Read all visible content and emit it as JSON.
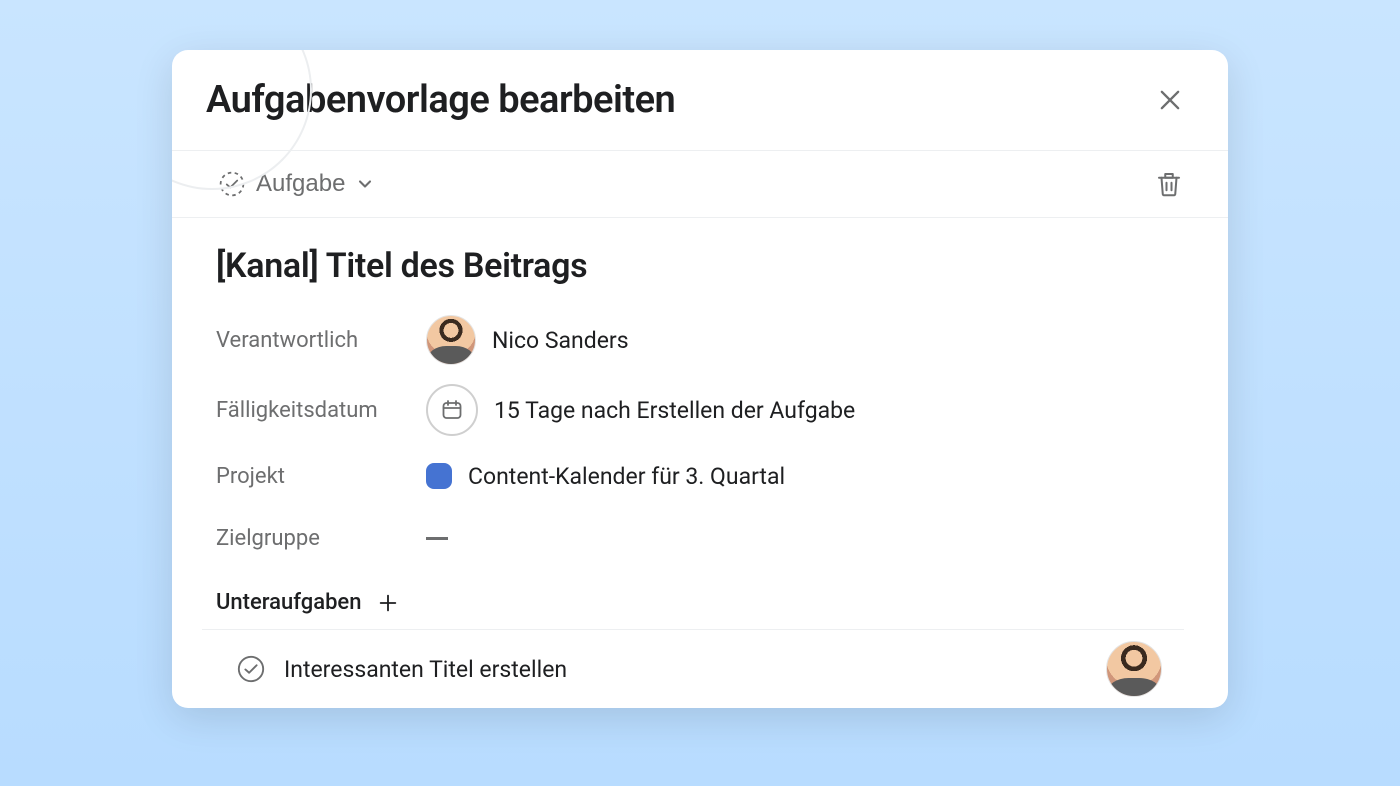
{
  "modal": {
    "title": "Aufgabenvorlage bearbeiten"
  },
  "toolbar": {
    "type_label": "Aufgabe"
  },
  "task": {
    "title": "[Kanal] Titel des Beitrags",
    "fields": {
      "assignee_label": "Verantwortlich",
      "assignee_name": "Nico Sanders",
      "due_label": "Fälligkeitsdatum",
      "due_value": "15 Tage nach Erstellen der Aufgabe",
      "project_label": "Projekt",
      "project_value": "Content-Kalender für 3. Quartal",
      "project_color": "#4573d2",
      "audience_label": "Zielgruppe",
      "audience_value": "—"
    }
  },
  "subtasks": {
    "header": "Unteraufgaben",
    "items": [
      {
        "title": "Interessanten Titel erstellen"
      }
    ]
  }
}
